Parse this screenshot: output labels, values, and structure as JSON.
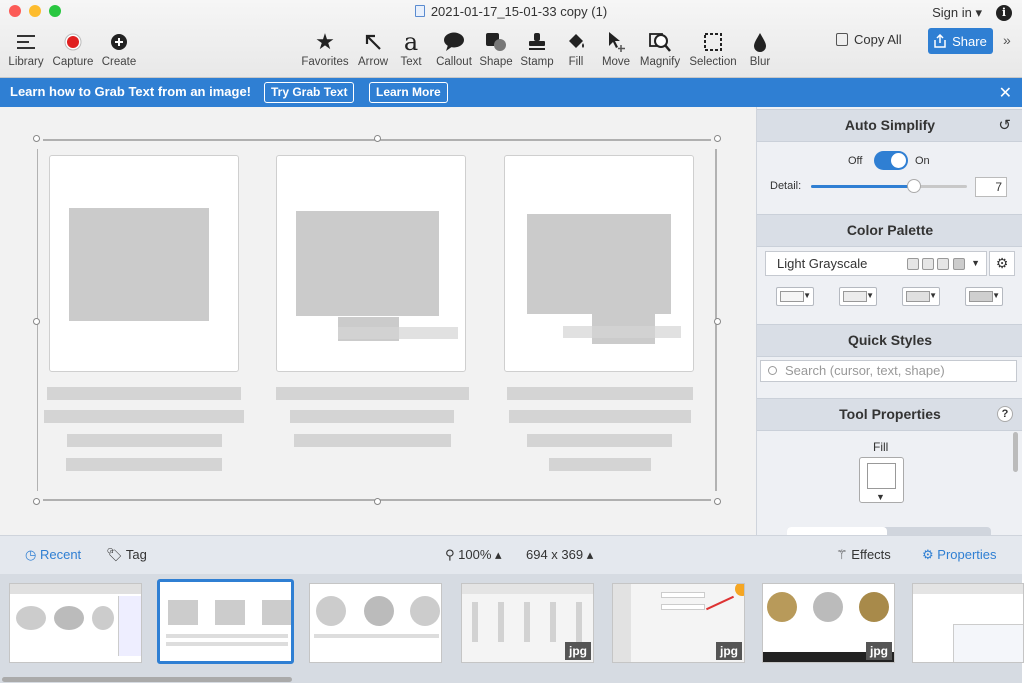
{
  "window": {
    "title": "2021-01-17_15-01-33 copy (1)",
    "sign_in": "Sign in ▾",
    "info": "i"
  },
  "left_tools": [
    {
      "label": "Library"
    },
    {
      "label": "Capture"
    },
    {
      "label": "Create"
    }
  ],
  "tools": [
    {
      "label": "Favorites"
    },
    {
      "label": "Arrow"
    },
    {
      "label": "Text"
    },
    {
      "label": "Callout"
    },
    {
      "label": "Shape"
    },
    {
      "label": "Stamp"
    },
    {
      "label": "Fill"
    },
    {
      "label": "Move"
    },
    {
      "label": "Magnify"
    },
    {
      "label": "Selection"
    },
    {
      "label": "Blur"
    }
  ],
  "toolbar": {
    "copy_all": "Copy All",
    "share": "Share",
    "more": "»"
  },
  "banner": {
    "message": "Learn how to Grab Text from an image!",
    "try_button": "Try Grab Text",
    "learn_button": "Learn More",
    "close": "✕"
  },
  "panel": {
    "auto_simplify": {
      "title": "Auto Simplify",
      "off": "Off",
      "on": "On",
      "detail_label": "Detail:",
      "detail_value": "7",
      "detail_fraction": 0.66
    },
    "color_palette": {
      "title": "Color Palette",
      "selected": "Light Grayscale"
    },
    "quick_styles": {
      "title": "Quick Styles",
      "search_placeholder": "Search (cursor, text, shape)"
    },
    "tool_properties": {
      "title": "Tool Properties",
      "help": "?",
      "fill_label": "Fill"
    }
  },
  "bottom": {
    "recent": "Recent",
    "tag": "Tag",
    "zoom": "100% ▴",
    "size": "694 x 369 ▴",
    "effects": "Effects",
    "properties": "Properties"
  },
  "tray": {
    "jpg_label": "jpg"
  },
  "colors": {
    "accent": "#2f7fd3",
    "close_red": "#fc5b57",
    "min_yellow": "#fdbc2e",
    "max_green": "#29c740"
  }
}
